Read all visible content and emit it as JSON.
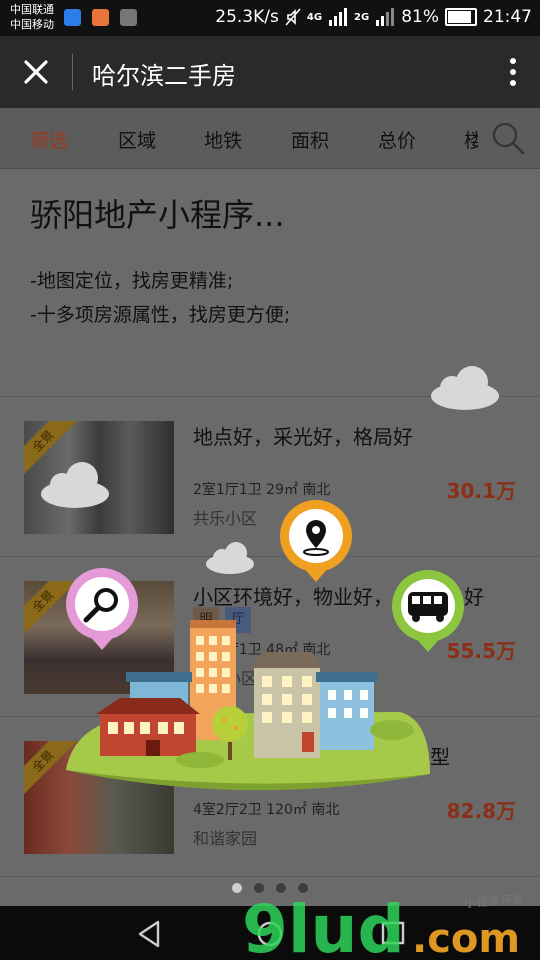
{
  "status_bar": {
    "carrier1": "中国联通",
    "carrier2": "中国移动",
    "speed": "25.3K/s",
    "net1": "4G",
    "net2": "2G",
    "battery_pct": "81%",
    "battery_level": 0.81,
    "time": "21:47"
  },
  "titlebar": {
    "title": "哈尔滨二手房"
  },
  "filters": [
    "筛选",
    "区域",
    "地铁",
    "面积",
    "总价",
    "楼"
  ],
  "promo": {
    "title": "骄阳地产小程序...",
    "line1": "-地图定位，找房更精准;",
    "line2": "-十多项房源属性，找房更方便;"
  },
  "listings": [
    {
      "tag": "全景",
      "title": "地点好，采光好，格局好",
      "spec": "2室1厅1卫 29㎡ 南北",
      "community": "共乐小区",
      "price": "30.1万"
    },
    {
      "tag": "全景",
      "title": "小区环境好，物业好，",
      "title_tail": "好",
      "badges": [
        "明",
        "厅"
      ],
      "spec": "2室1厅1卫 48㎡ 南北",
      "community": "骄阳小区",
      "price": "55.5万"
    },
    {
      "tag": "全景",
      "title_tail": "户型",
      "spec": "4室2厅2卫 120㎡ 南北",
      "community": "和谐家园",
      "price": "82.8万"
    }
  ],
  "overlay": {
    "pin_icons": [
      "search-icon",
      "location-icon",
      "bus-icon"
    ],
    "colors": {
      "pink": "#e59ad8",
      "orange": "#f0a020",
      "green": "#8cc63f",
      "grass": "#a7c94a"
    }
  },
  "pager": {
    "count": 4,
    "active": 0
  },
  "watermark": {
    "brand": "9lud",
    "domain": ".com",
    "tagline": "小程序开发"
  }
}
